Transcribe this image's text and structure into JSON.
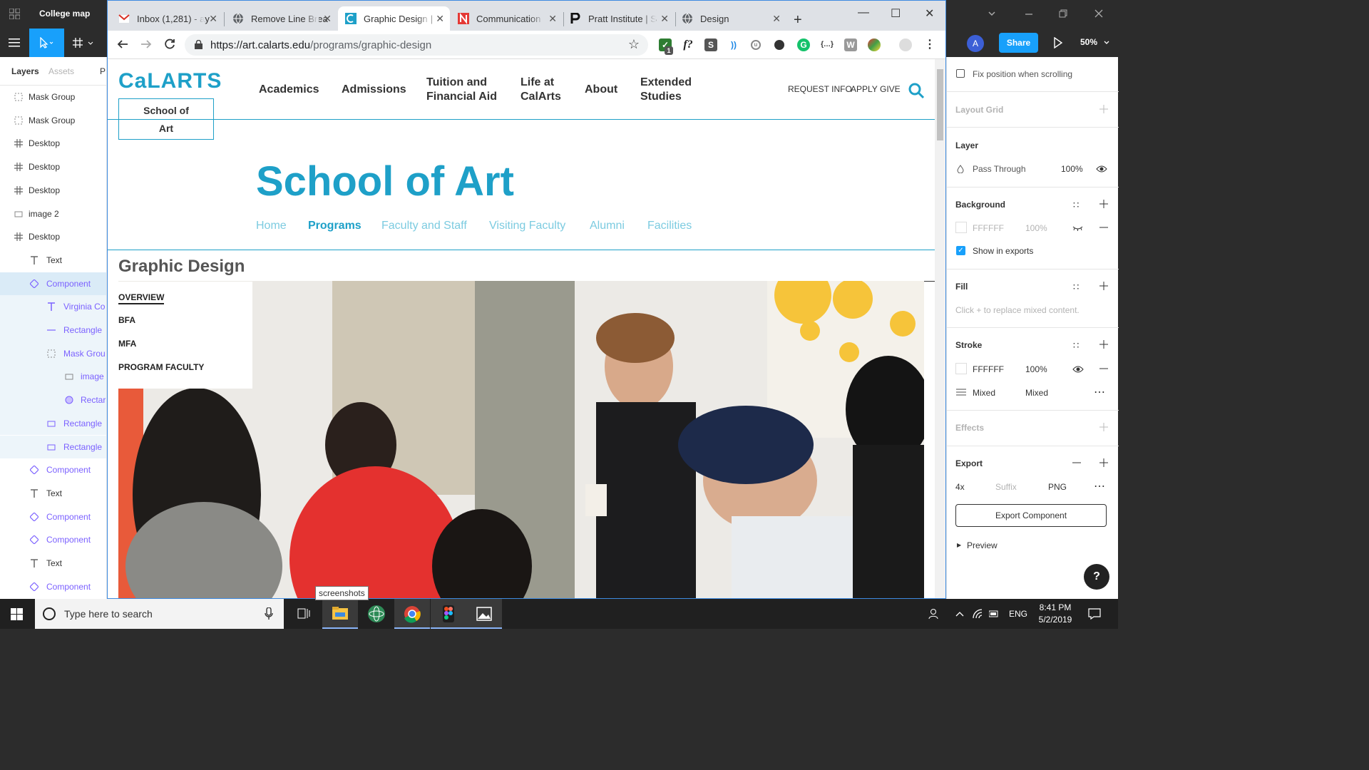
{
  "figma": {
    "file_title": "College map",
    "share_label": "Share",
    "avatar_initial": "A",
    "zoom": "50%",
    "layers_tabs": [
      "Layers",
      "Assets",
      "P"
    ],
    "layers": [
      {
        "label": "Mask Group",
        "icon": "mask-icon"
      },
      {
        "label": "Mask Group",
        "icon": "mask-icon"
      },
      {
        "label": "Desktop",
        "icon": "frame-icon"
      },
      {
        "label": "Desktop",
        "icon": "frame-icon"
      },
      {
        "label": "Desktop",
        "icon": "frame-icon"
      },
      {
        "label": "image 2",
        "icon": "image-icon"
      },
      {
        "label": "Desktop",
        "icon": "frame-icon"
      },
      {
        "label": "Text",
        "icon": "text-icon"
      },
      {
        "label": "Component",
        "icon": "component-icon"
      },
      {
        "label": "Virginia Co",
        "icon": "text-icon"
      },
      {
        "label": "Rectangle",
        "icon": "line-icon"
      },
      {
        "label": "Mask Grou",
        "icon": "mask-icon"
      },
      {
        "label": "image",
        "icon": "image-icon"
      },
      {
        "label": "Rectar",
        "icon": "ellipse-icon"
      },
      {
        "label": "Rectangle",
        "icon": "rect-icon"
      },
      {
        "label": "Rectangle",
        "icon": "rect-icon"
      },
      {
        "label": "Component",
        "icon": "component-icon"
      },
      {
        "label": "Text",
        "icon": "text-icon"
      },
      {
        "label": "Component",
        "icon": "component-icon"
      },
      {
        "label": "Component",
        "icon": "component-icon"
      },
      {
        "label": "Text",
        "icon": "text-icon"
      },
      {
        "label": "Component",
        "icon": "component-icon"
      }
    ],
    "props": {
      "fix_position": "Fix position when scrolling",
      "layout_grid": "Layout Grid",
      "layer_title": "Layer",
      "blend_mode": "Pass Through",
      "layer_opacity": "100%",
      "background_title": "Background",
      "bg_hex": "FFFFFF",
      "bg_opacity": "100%",
      "show_in_exports": "Show in exports",
      "fill_title": "Fill",
      "fill_hint": "Click + to replace mixed content.",
      "stroke_title": "Stroke",
      "stroke_hex": "FFFFFF",
      "stroke_opacity": "100%",
      "stroke_weight": "Mixed",
      "stroke_align": "Mixed",
      "effects_title": "Effects",
      "export_title": "Export",
      "export_scale": "4x",
      "export_suffix_placeholder": "Suffix",
      "export_format": "PNG",
      "export_button": "Export Component",
      "preview_label": "Preview",
      "help": "?"
    }
  },
  "browser": {
    "tabs": [
      {
        "title": "Inbox (1,281) - ay",
        "icon": "gmail-icon",
        "color": "#d93025"
      },
      {
        "title": "Remove Line Brea",
        "icon": "globe-icon",
        "color": "#5f6368"
      },
      {
        "title": "Graphic Design |",
        "icon": "calarts-icon",
        "color": "#1ea0c8"
      },
      {
        "title": "Communication",
        "icon": "n-icon",
        "color": "#e53935"
      },
      {
        "title": "Pratt Institute | S",
        "icon": "pratt-icon",
        "color": "#111111"
      },
      {
        "title": "Design",
        "icon": "globe-icon",
        "color": "#5f6368"
      }
    ],
    "url_host": "https://art.calarts.edu",
    "url_path": "/programs/graphic-design",
    "ext_badge": "1"
  },
  "site": {
    "logo": "CaLARTS",
    "school_box_line1": "School of",
    "school_box_line2": "Art",
    "main_nav": [
      {
        "l1": "Academics",
        "l2": ""
      },
      {
        "l1": "Admissions",
        "l2": ""
      },
      {
        "l1": "Tuition and",
        "l2": "Financial Aid"
      },
      {
        "l1": "Life at",
        "l2": "CalArts"
      },
      {
        "l1": "About",
        "l2": ""
      },
      {
        "l1": "Extended",
        "l2": "Studies"
      }
    ],
    "util_nav": [
      "REQUEST INFO",
      "APPLY",
      "GIVE"
    ],
    "school_title": "School of Art",
    "sub_nav": [
      "Home",
      "Programs",
      "Faculty and Staff",
      "Visiting Faculty",
      "Alumni",
      "Facilities"
    ],
    "program_title": "Graphic Design",
    "side_menu": [
      "OVERVIEW",
      "BFA",
      "MFA",
      "PROGRAM FACULTY"
    ],
    "accent": "#1ea0c8"
  },
  "taskbar": {
    "search_placeholder": "Type here to search",
    "tooltip": "screenshots",
    "lang": "ENG",
    "time": "8:41 PM",
    "date": "5/2/2019"
  }
}
